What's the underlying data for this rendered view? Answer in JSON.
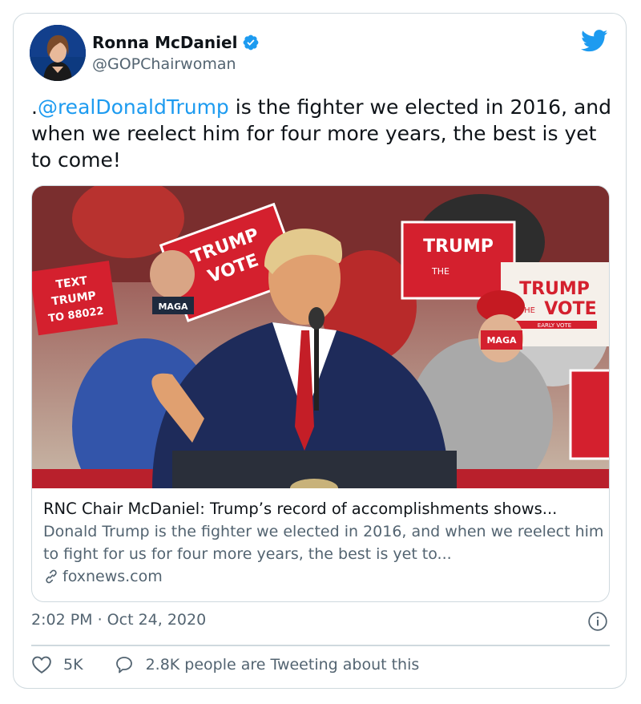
{
  "author": {
    "name": "Ronna McDaniel",
    "handle": "@GOPChairwoman"
  },
  "tweet": {
    "prefix": ".",
    "mention": "@realDonaldTrump",
    "text_after_mention": " is the fighter we elected in 2016, and when we reelect him for four more years, the best is yet to come!"
  },
  "link_card": {
    "title": "RNC Chair McDaniel: Trump’s record of accomplishments shows...",
    "description": "Donald Trump is the fighter we elected in 2016, and when we reelect him to fight for us for four more years, the best is yet to...",
    "domain": "foxnews.com",
    "image_signs": {
      "sign_text_1": "TRUMP",
      "sign_text_2": "THE",
      "sign_text_3": "VOTE",
      "sign_text_4": "TEXT",
      "sign_text_5": "TRUMP",
      "sign_text_6": "TO 88022",
      "sign_text_7": "EARLY VOTE",
      "hat_text": "MAGA"
    }
  },
  "meta": {
    "timestamp": "2:02 PM · Oct 24, 2020"
  },
  "actions": {
    "likes": "5K",
    "conversation": "2.8K people are Tweeting about this"
  },
  "colors": {
    "accent": "#1d9bf0",
    "text": "#0f1419",
    "muted": "#536471",
    "border": "#cfd9de",
    "sign_red": "#d4202e"
  },
  "icons": [
    "verified-badge-icon",
    "twitter-bird-icon",
    "info-icon",
    "heart-icon",
    "speech-bubble-icon",
    "link-icon"
  ]
}
